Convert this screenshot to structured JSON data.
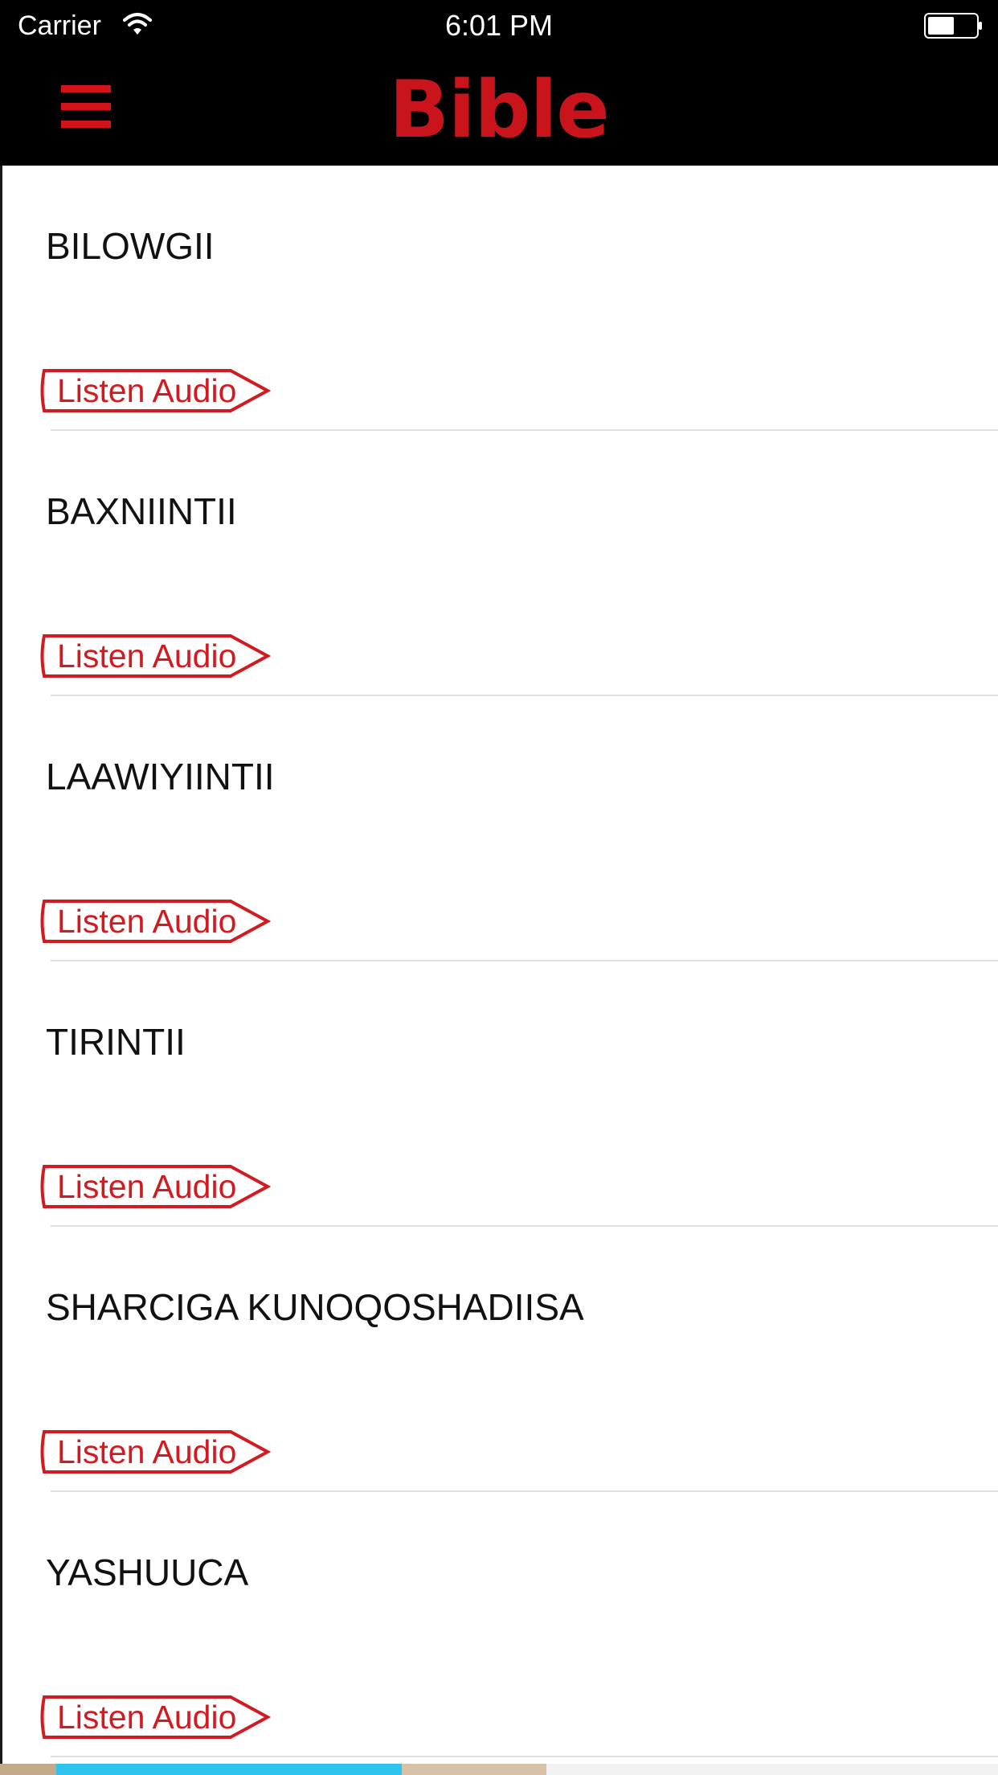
{
  "status_bar": {
    "carrier": "Carrier",
    "time": "6:01 PM",
    "wifi_icon": "wifi-icon",
    "battery_icon": "battery-icon"
  },
  "header": {
    "title": "Bible",
    "menu_icon": "hamburger-menu-icon",
    "title_color": "#c8141a",
    "background": "#000000"
  },
  "books": [
    {
      "title": "BILOWGII",
      "audio_label": "Listen Audio"
    },
    {
      "title": "BAXNIINTII",
      "audio_label": "Listen Audio"
    },
    {
      "title": "LAAWIYIINTII",
      "audio_label": "Listen Audio"
    },
    {
      "title": "TIRINTII",
      "audio_label": "Listen Audio"
    },
    {
      "title": "SHARCIGA KUNOQOSHADIISA",
      "audio_label": "Listen Audio"
    },
    {
      "title": "YASHUUCA",
      "audio_label": "Listen Audio"
    }
  ],
  "colors": {
    "accent": "#d21b21"
  }
}
